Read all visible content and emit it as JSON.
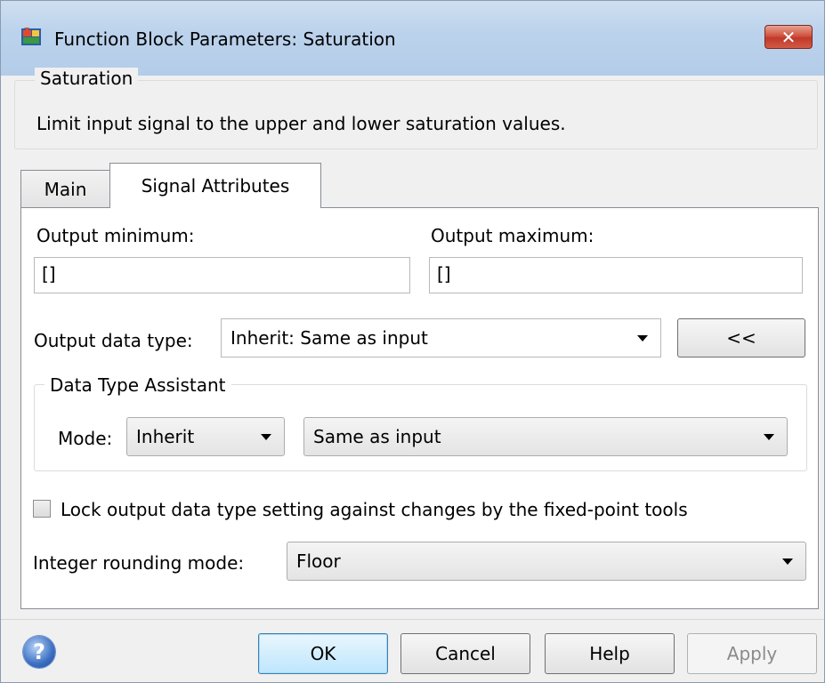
{
  "window": {
    "title": "Function Block Parameters: Saturation",
    "close_label": "✕"
  },
  "block": {
    "name": "Saturation",
    "description": "Limit input signal to the upper and lower saturation values."
  },
  "tabs": [
    {
      "label": "Main",
      "active": false
    },
    {
      "label": "Signal Attributes",
      "active": true
    }
  ],
  "signal": {
    "output_min_label": "Output minimum:",
    "output_min_value": "[]",
    "output_max_label": "Output maximum:",
    "output_max_value": "[]",
    "data_type_label": "Output data type:",
    "data_type_value": "Inherit: Same as input",
    "toggle_assistant_label": "<<",
    "assistant": {
      "title": "Data Type Assistant",
      "mode_label": "Mode:",
      "mode_value": "Inherit",
      "inherit_value": "Same as input"
    },
    "lock_label": "Lock output data type setting against changes by the fixed-point tools",
    "lock_checked": false,
    "rounding_label": "Integer rounding mode:",
    "rounding_value": "Floor"
  },
  "buttons": {
    "help_icon": "?",
    "ok": "OK",
    "cancel": "Cancel",
    "help": "Help",
    "apply": "Apply"
  },
  "colors": {
    "titlebar": "#bcd3ec",
    "close": "#c0392b",
    "default_button": "#bee6fd"
  }
}
